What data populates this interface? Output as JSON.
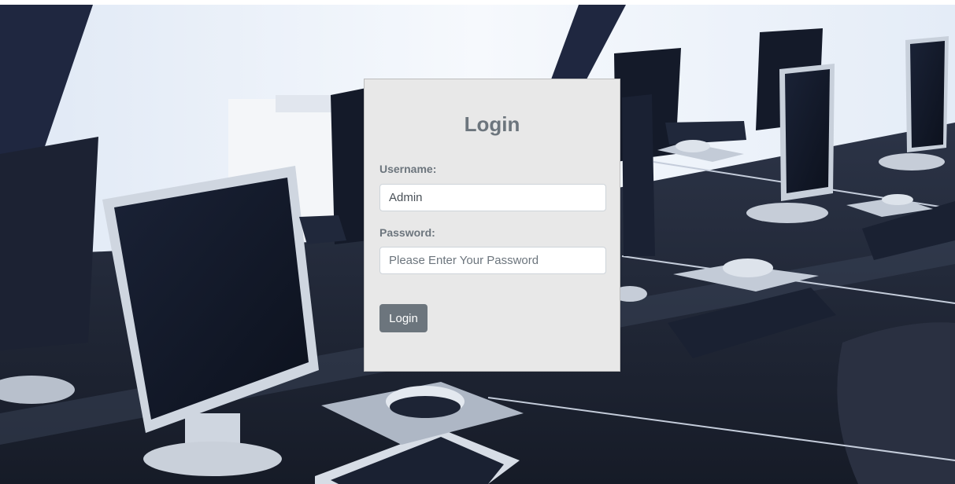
{
  "form": {
    "title": "Login",
    "username_label": "Username:",
    "username_value": "Admin",
    "password_label": "Password:",
    "password_placeholder": "Please Enter Your Password",
    "submit_label": "Login"
  },
  "colors": {
    "card_bg": "#e8e8e8",
    "text_muted": "#6c757d",
    "button_bg": "#6c757d",
    "desk": "#1e2433",
    "wall": "#eef3fb"
  },
  "background": {
    "subject": "computer-lab-photo"
  }
}
